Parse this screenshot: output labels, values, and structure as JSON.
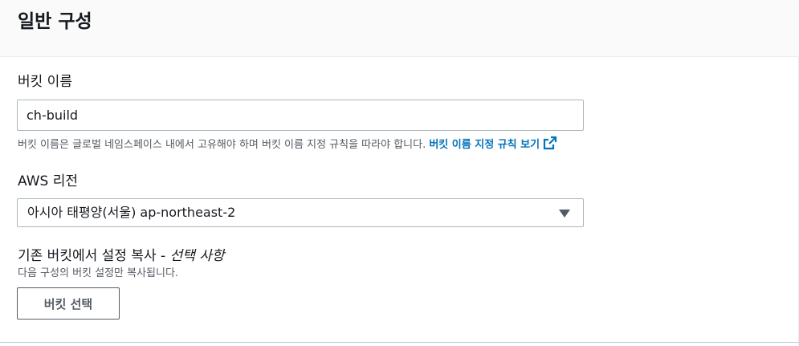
{
  "panel": {
    "title": "일반 구성"
  },
  "bucket_name": {
    "label": "버킷 이름",
    "value": "ch-build",
    "hint": "버킷 이름은 글로벌 네임스페이스 내에서 고유해야 하며 버킷 이름 지정 규칙을 따라야 합니다.",
    "link_text": "버킷 이름 지정 규칙 보기",
    "link_icon": "external-link-icon"
  },
  "region": {
    "label": "AWS 리전",
    "selected": "아시아 태평양(서울) ap-northeast-2",
    "caret_icon": "caret-down-icon"
  },
  "copy_settings": {
    "label": "기존 버킷에서 설정 복사 -",
    "optional": "선택 사항",
    "description": "다음 구성의 버킷 설정만 복사됩니다.",
    "button_label": "버킷 선택"
  },
  "colors": {
    "link": "#0073bb",
    "text": "#16191f",
    "secondary_text": "#545b64",
    "border": "#aab7b8",
    "header_bg": "#fafafa"
  }
}
